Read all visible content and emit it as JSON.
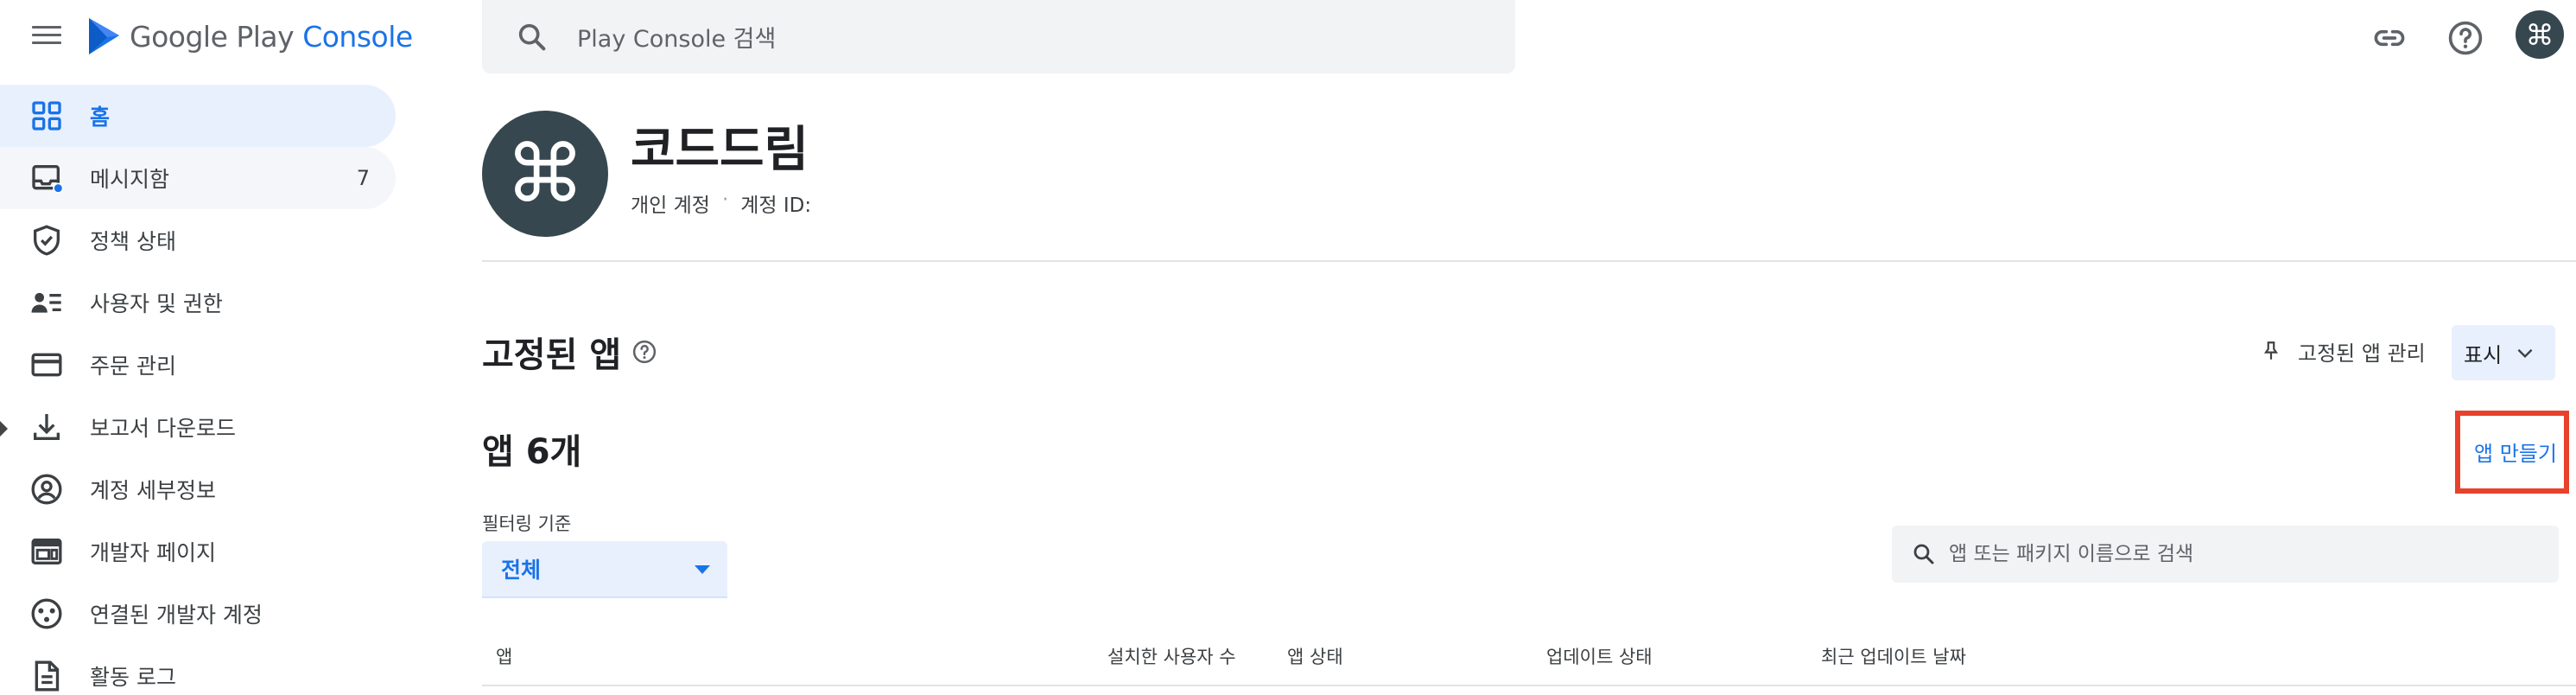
{
  "header": {
    "logo_brand": "Google Play",
    "logo_product": "Console",
    "search_placeholder": "Play Console 검색",
    "link_icon": "link-icon",
    "help_icon": "help-icon",
    "account_avatar_glyph": "⌘"
  },
  "sidebar": {
    "items": [
      {
        "label": "홈",
        "icon": "dashboard-icon"
      },
      {
        "label": "메시지함",
        "icon": "inbox-icon",
        "badge": "7"
      },
      {
        "label": "정책 상태",
        "icon": "shield-check-icon"
      },
      {
        "label": "사용자 및 권한",
        "icon": "users-list-icon"
      },
      {
        "label": "주문 관리",
        "icon": "credit-card-icon"
      },
      {
        "label": "보고서 다운로드",
        "icon": "download-icon"
      },
      {
        "label": "계정 세부정보",
        "icon": "account-circle-icon"
      },
      {
        "label": "개발자 페이지",
        "icon": "web-page-icon"
      },
      {
        "label": "연결된 개발자 계정",
        "icon": "linked-accounts-icon"
      },
      {
        "label": "활동 로그",
        "icon": "document-log-icon"
      }
    ]
  },
  "developer": {
    "avatar_glyph": "⌘",
    "name": "코드드림",
    "account_type": "개인 계정",
    "account_id_label": "계정 ID:"
  },
  "pinned": {
    "title": "고정된 앱",
    "manage_label": "고정된 앱 관리",
    "show_label": "표시"
  },
  "apps": {
    "count_title": "앱 6개",
    "create_label": "앱 만들기",
    "filter_label": "필터링 기준",
    "filter_value": "전체",
    "search_placeholder": "앱 또는 패키지 이름으로 검색",
    "columns": [
      "앱",
      "설치한 사용자 수",
      "앱 상태",
      "업데이트 상태",
      "최근 업데이트 날짜"
    ]
  },
  "colors": {
    "accent": "#1a73e8",
    "active_nav_bg": "#e8f0fe",
    "avatar_bg": "#37474f",
    "highlight_box": "#e8412c"
  }
}
